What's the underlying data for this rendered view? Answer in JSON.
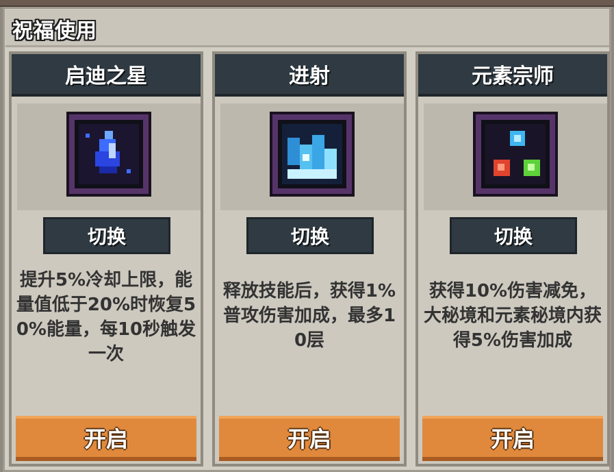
{
  "panel": {
    "title": "祝福使用"
  },
  "cards": [
    {
      "name": "启迪之星",
      "icon": "blue-crystal-icon",
      "switch_label": "切换",
      "description": "提升5%冷却上限，能量值低于20%时恢复50%能量，每10秒触发一次",
      "open_label": "开启"
    },
    {
      "name": "进射",
      "icon": "ice-spike-icon",
      "switch_label": "切换",
      "description": "释放技能后，获得1%普攻伤害加成，最多10层",
      "open_label": "开启"
    },
    {
      "name": "元素宗师",
      "icon": "element-orbs-icon",
      "switch_label": "切换",
      "description": "获得10%伤害减免，大秘境和元素秘境内获得5%伤害加成",
      "open_label": "开启"
    }
  ],
  "colors": {
    "header_bg": "#2f3a42",
    "button_orange": "#e0893c",
    "icon_frame": "#56346a"
  }
}
